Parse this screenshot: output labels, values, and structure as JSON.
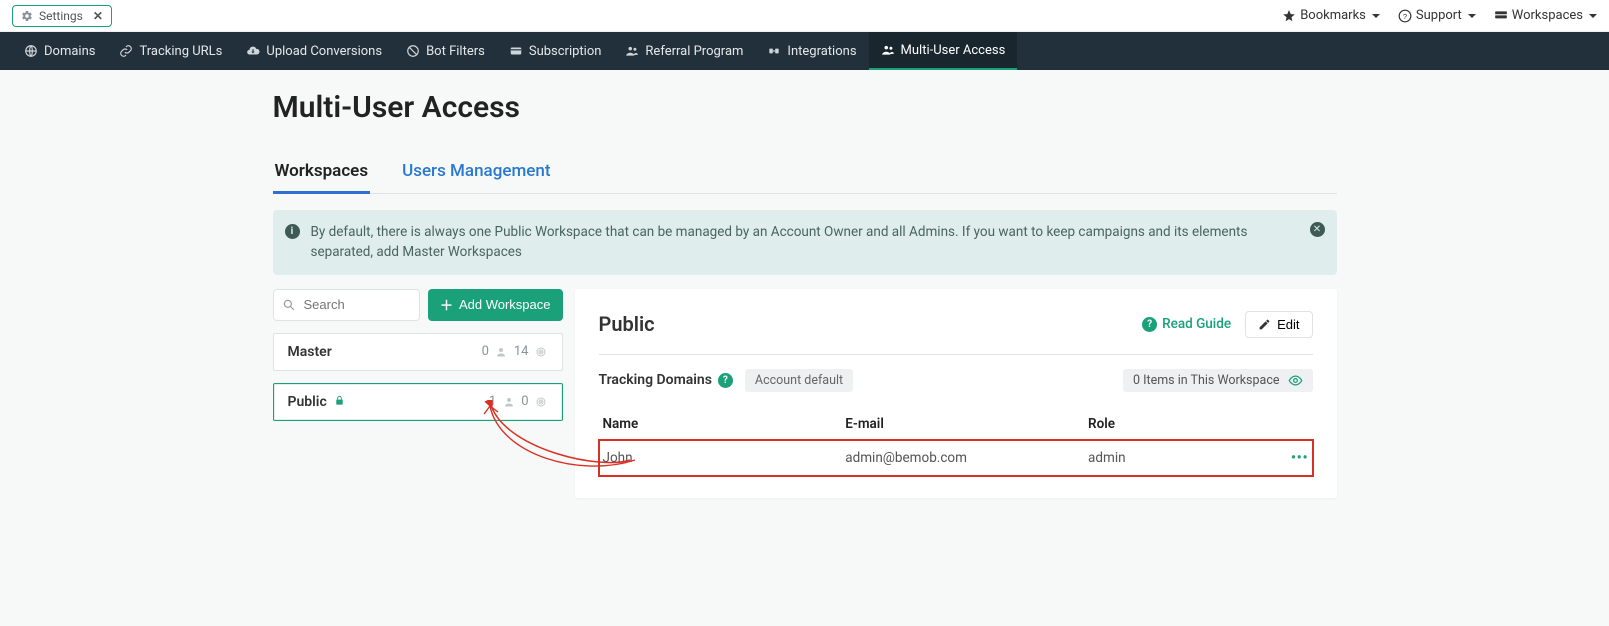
{
  "tab": {
    "label": "Settings"
  },
  "topbar": {
    "bookmarks": "Bookmarks",
    "support": "Support",
    "workspaces": "Workspaces"
  },
  "nav": {
    "domains": "Domains",
    "tracking_urls": "Tracking URLs",
    "upload_conversions": "Upload Conversions",
    "bot_filters": "Bot Filters",
    "subscription": "Subscription",
    "referral": "Referral Program",
    "integrations": "Integrations",
    "multi_user": "Multi-User Access"
  },
  "page": {
    "title": "Multi-User Access"
  },
  "subtabs": {
    "workspaces": "Workspaces",
    "users_mgmt": "Users Management"
  },
  "info": {
    "text": "By default, there is always one Public Workspace that can be managed by an Account Owner and all Admins. If you want to keep campaigns and its elements separated, add Master Workspaces"
  },
  "sidebar": {
    "search_placeholder": "Search",
    "add_label": "Add Workspace",
    "items": [
      {
        "name": "Master",
        "users": "0",
        "targets": "14",
        "locked": false
      },
      {
        "name": "Public",
        "users": "1",
        "targets": "0",
        "locked": true
      }
    ]
  },
  "panel": {
    "title": "Public",
    "read_guide": "Read Guide",
    "edit": "Edit",
    "tracking_domains_label": "Tracking Domains",
    "account_default_badge": "Account default",
    "items_in_workspace": "0 Items in This Workspace"
  },
  "table": {
    "headers": {
      "name": "Name",
      "email": "E-mail",
      "role": "Role"
    },
    "rows": [
      {
        "name": "John",
        "email": "admin@bemob.com",
        "role": "admin"
      }
    ]
  }
}
